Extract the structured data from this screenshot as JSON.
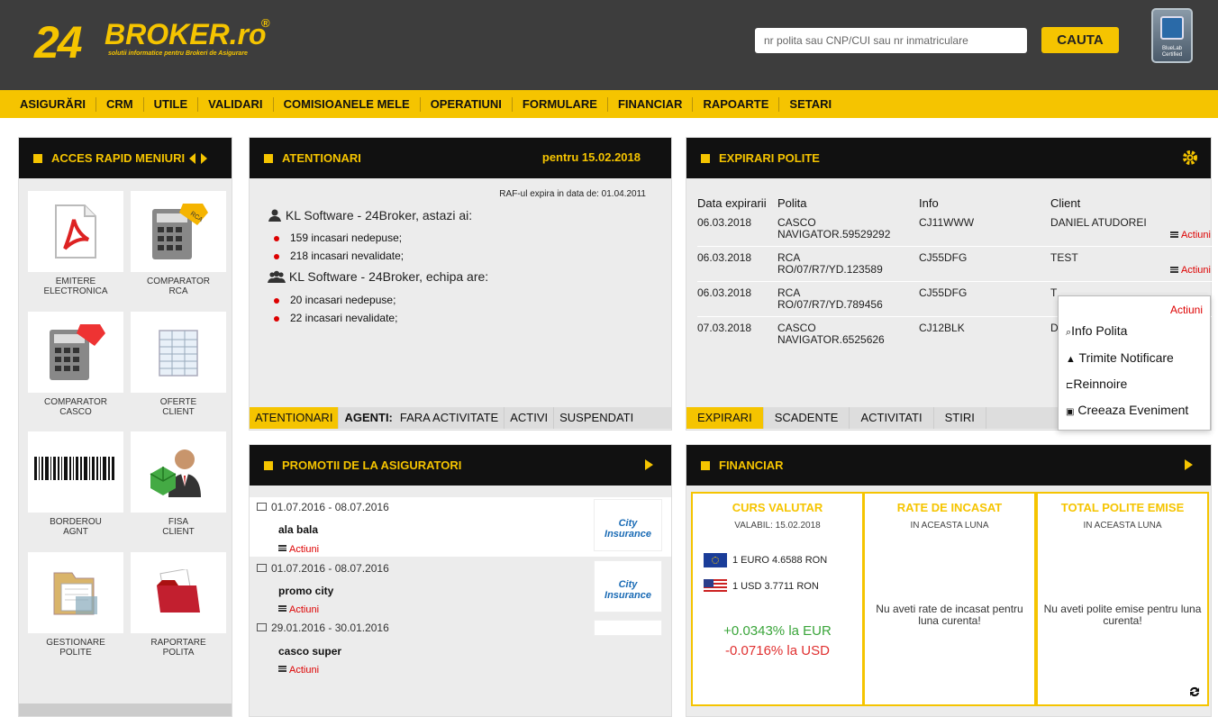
{
  "header": {
    "logo_number": "24",
    "logo_brand": "BROKER.ro",
    "logo_reg": "®",
    "logo_tagline": "solutii informatice pentru Brokeri de Asigurare",
    "search_placeholder": "nr polita sau CNP/CUI sau nr inmatriculare",
    "search_button": "CAUTA",
    "cert_text": "BlueLab Certified"
  },
  "nav": [
    "ASIGURĂRI",
    "CRM",
    "UTILE",
    "VALIDARI",
    "COMISIOANELE MELE",
    "OPERATIUNI",
    "FORMULARE",
    "FINANCIAR",
    "RAPOARTE",
    "SETARI"
  ],
  "quick": {
    "title": "ACCES RAPID MENIURI",
    "tiles": [
      {
        "label": "EMITERE\nELECTRONICA"
      },
      {
        "label": "COMPARATOR\nRCA"
      },
      {
        "label": "COMPARATOR\nCASCO"
      },
      {
        "label": "OFERTE\nCLIENT"
      },
      {
        "label": "BORDEROU\nAGNT"
      },
      {
        "label": "FISA\nCLIENT"
      },
      {
        "label": "GESTIONARE\nPOLITE"
      },
      {
        "label": "RAPORTARE\nPOLITA"
      }
    ]
  },
  "alerts": {
    "title": "ATENTIONARI",
    "date": "pentru 15.02.2018",
    "raf": "RAF-ul expira in data de: 01.04.2011",
    "user_heading": "KL Software - 24Broker, astazi ai:",
    "user_items": [
      "159 incasari nedepuse;",
      "218 incasari nevalidate;"
    ],
    "team_heading": "KL Software - 24Broker, echipa are:",
    "team_items": [
      "20 incasari nedepuse;",
      "22 incasari nevalidate;"
    ],
    "tabs": [
      "ATENTIONARI",
      "AGENTI:",
      "FARA ACTIVITATE",
      "ACTIVI",
      "SUSPENDATI"
    ]
  },
  "expiry": {
    "title": "EXPIRARI POLITE",
    "columns": [
      "Data expirarii",
      "Polita",
      "Info",
      "Client"
    ],
    "rows": [
      {
        "date": "06.03.2018",
        "policy": "CASCO\nNAVIGATOR.59529292",
        "info": "CJ11WWW",
        "client": "DANIEL ATUDOREI",
        "action": "Actiuni"
      },
      {
        "date": "06.03.2018",
        "policy": "RCA\nRO/07/R7/YD.123589",
        "info": "CJ55DFG",
        "client": "TEST",
        "action": "Actiuni"
      },
      {
        "date": "06.03.2018",
        "policy": "RCA\nRO/07/R7/YD.789456",
        "info": "CJ55DFG",
        "client": "T",
        "action": ""
      },
      {
        "date": "07.03.2018",
        "policy": "CASCO\nNAVIGATOR.6525626",
        "info": "CJ12BLK",
        "client": "D",
        "action": ""
      }
    ],
    "tabs": [
      "EXPIRARI",
      "SCADENTE",
      "ACTIVITATI",
      "STIRI"
    ],
    "dropdown": {
      "title": "Actiuni",
      "items": [
        "Info Polita",
        "Trimite Notificare",
        "Reinnoire",
        "Creeaza Eveniment"
      ]
    }
  },
  "promo": {
    "title": "PROMOTII DE LA ASIGURATORI",
    "items": [
      {
        "dates": "01.07.2016 - 08.07.2016",
        "name": "ala bala",
        "action": "Actiuni",
        "logo": "City Insurance"
      },
      {
        "dates": "01.07.2016 - 08.07.2016",
        "name": "promo city",
        "action": "Actiuni",
        "logo": "City Insurance"
      },
      {
        "dates": "29.01.2016 - 30.01.2016",
        "name": "casco super",
        "action": "Actiuni",
        "logo": ""
      }
    ]
  },
  "financial": {
    "title": "FINANCIAR",
    "curs": {
      "title": "CURS VALUTAR",
      "valid": "VALABIL: 15.02.2018",
      "eur": "1 EURO 4.6588 RON",
      "usd": "1 USD 3.7711 RON",
      "eur_change": "+0.0343% la EUR",
      "usd_change": "-0.0716% la USD"
    },
    "rate": {
      "title": "RATE DE INCASAT",
      "sub": "IN ACEASTA LUNA",
      "msg": "Nu aveti rate de incasat pentru luna curenta!"
    },
    "total": {
      "title": "TOTAL POLITE EMISE",
      "sub": "IN ACEASTA LUNA",
      "msg": "Nu aveti polite emise pentru luna curenta!"
    }
  },
  "colors": {
    "accent": "#f5c400",
    "header": "#3d3d3d",
    "panel_header": "#111111",
    "positive": "#3aa53a",
    "negative": "#e03030"
  }
}
